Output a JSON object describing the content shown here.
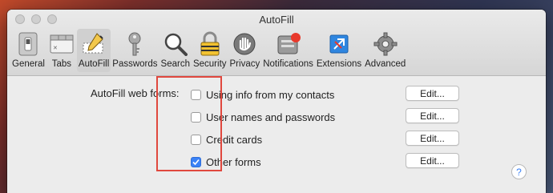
{
  "window": {
    "title": "AutoFill"
  },
  "toolbar": {
    "items": [
      {
        "label": "General",
        "icon": "general-icon"
      },
      {
        "label": "Tabs",
        "icon": "tabs-icon"
      },
      {
        "label": "AutoFill",
        "icon": "autofill-icon",
        "active": true
      },
      {
        "label": "Passwords",
        "icon": "key-icon"
      },
      {
        "label": "Search",
        "icon": "search-icon"
      },
      {
        "label": "Security",
        "icon": "lock-icon"
      },
      {
        "label": "Privacy",
        "icon": "hand-icon"
      },
      {
        "label": "Notifications",
        "icon": "notifications-icon"
      },
      {
        "label": "Extensions",
        "icon": "puzzle-icon"
      },
      {
        "label": "Advanced",
        "icon": "gear-icon"
      }
    ]
  },
  "autofill": {
    "section_label": "AutoFill web forms:",
    "options": [
      {
        "label": "Using info from my contacts",
        "checked": false,
        "edit_label": "Edit..."
      },
      {
        "label": "User names and passwords",
        "checked": false,
        "edit_label": "Edit..."
      },
      {
        "label": "Credit cards",
        "checked": false,
        "edit_label": "Edit..."
      },
      {
        "label": "Other forms",
        "checked": true,
        "edit_label": "Edit..."
      }
    ]
  },
  "help": {
    "label": "?"
  },
  "colors": {
    "accent": "#3b82f6",
    "highlight": "#e0483e"
  }
}
